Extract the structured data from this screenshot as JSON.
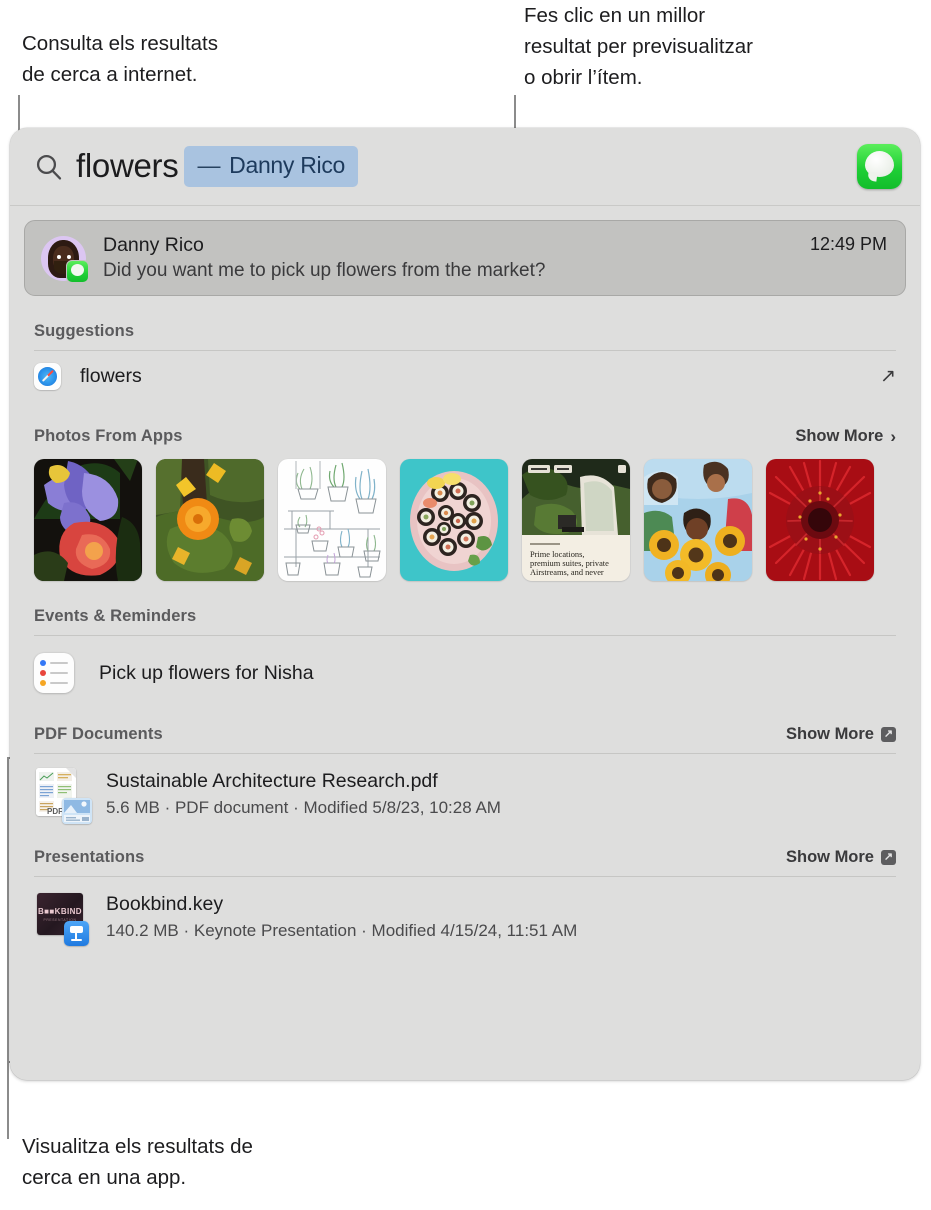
{
  "callouts": [
    {
      "id": "internet",
      "text": "Consulta els resultats\nde cerca a internet."
    },
    {
      "id": "preview",
      "text": "Fes clic en un millor\nresultat per previsualitzar\no obrir l’ítem."
    },
    {
      "id": "app",
      "text": "Visualitza els resultats de\ncerca en una app."
    }
  ],
  "search": {
    "icon": "search-icon",
    "query": "flowers",
    "token_dash": "—",
    "token_label": "Danny Rico",
    "app_badge": "messages-icon"
  },
  "top_hit": {
    "avatar": "memoji-avatar",
    "badge": "messages-badge-icon",
    "title": "Danny Rico",
    "subtitle": "Did you want me to pick up flowers from the market?",
    "time": "12:49 PM"
  },
  "sections": [
    {
      "id": "suggestions",
      "title": "Suggestions",
      "show_more": null,
      "rows": [
        {
          "icon": "safari-icon",
          "label": "flowers",
          "trailing_icon": "arrow-up-right-icon"
        }
      ]
    },
    {
      "id": "photos-from-apps",
      "title": "Photos From Apps",
      "show_more": {
        "label": "Show More",
        "glyph": "›",
        "style": "chevron"
      },
      "thumbnails": [
        {
          "name": "purple-iris-flowers-photo",
          "alt": "Purple iris with red dahlia"
        },
        {
          "name": "orange-marigold-garden-photo",
          "alt": "Orange marigold in garden"
        },
        {
          "name": "potted-plants-illustration",
          "alt": "Line illustration of potted plants"
        },
        {
          "name": "sushi-platter-photo",
          "alt": "Sushi platter on teal background"
        },
        {
          "name": "airstream-listing-card",
          "alt": "Garden listing card",
          "caption": "Prime locations,\npremium suites, private\nAirstreams, and never"
        },
        {
          "name": "friends-with-sunflowers-photo",
          "alt": "Three friends holding sunflowers"
        },
        {
          "name": "red-gerbera-closeup-photo",
          "alt": "Red gerbera daisy close-up"
        }
      ]
    },
    {
      "id": "events-reminders",
      "title": "Events & Reminders",
      "show_more": null,
      "rows": [
        {
          "icon": "reminders-icon",
          "label": "Pick up flowers for Nisha"
        }
      ]
    },
    {
      "id": "pdf-documents",
      "title": "PDF Documents",
      "show_more": {
        "label": "Show More",
        "glyph": "↗",
        "style": "kbd"
      },
      "files": [
        {
          "icon": "pdf-file-icon",
          "title": "Sustainable Architecture Research.pdf",
          "meta": "5.6 MB · PDF document · Modified 5/8/23, 10:28 AM",
          "icon_label": "PDF"
        }
      ]
    },
    {
      "id": "presentations",
      "title": "Presentations",
      "show_more": {
        "label": "Show More",
        "glyph": "↗",
        "style": "kbd"
      },
      "files": [
        {
          "icon": "keynote-file-icon",
          "title": "Bookbind.key",
          "meta": "140.2 MB · Keynote Presentation · Modified 4/15/24, 11:51 AM",
          "icon_label": "B■■KBIND",
          "icon_sublabel": "PRESENTATION"
        }
      ]
    }
  ],
  "colors": {
    "window_bg": "#dededd",
    "top_hit_bg": "#c2c2c0",
    "token_bg": "#a9c3e0",
    "token_text": "#1d3a5c",
    "messages_green": "#1fcf36",
    "leader_line": "#8b8b8b"
  }
}
